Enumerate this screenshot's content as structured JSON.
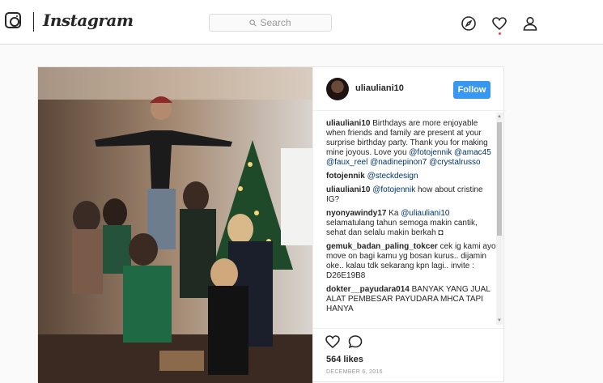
{
  "header": {
    "brand": "Instagram",
    "search_placeholder": "Search",
    "icons": [
      "instagram-logo-icon",
      "compass-icon",
      "heart-icon",
      "profile-icon"
    ],
    "notification_color": "#ed4956"
  },
  "post": {
    "username": "uliauliani10",
    "follow_label": "Follow",
    "follow_color": "#3897f0",
    "comments": [
      {
        "user": "uliauliani10",
        "parts": [
          {
            "t": " Birthdays are more enjoyable when friends and family are present at your surprise birthday party. Thank you for making mine joyous. Love you "
          },
          {
            "t": "@fotojennik",
            "m": true
          },
          {
            "t": " "
          },
          {
            "t": "@amac45",
            "m": true
          },
          {
            "t": " "
          },
          {
            "t": "@faux_reel",
            "m": true
          },
          {
            "t": " "
          },
          {
            "t": "@nadinepinon7",
            "m": true
          },
          {
            "t": " "
          },
          {
            "t": "@crystalrusso",
            "m": true
          }
        ]
      },
      {
        "user": "fotojennik",
        "parts": [
          {
            "t": " "
          },
          {
            "t": "@steckdesign",
            "m": true
          }
        ]
      },
      {
        "user": "uliauliani10",
        "parts": [
          {
            "t": " "
          },
          {
            "t": "@fotojennik",
            "m": true
          },
          {
            "t": " how about cristine IG?"
          }
        ]
      },
      {
        "user": "nyonyawindy17",
        "parts": [
          {
            "t": " Ka "
          },
          {
            "t": "@uliauliani10",
            "m": true
          },
          {
            "t": " selamatulang tahun semoga makin cantik, sehat dan selalu makin berkah ◘"
          }
        ]
      },
      {
        "user": "gemuk_badan_paling_tokcer",
        "parts": [
          {
            "t": " cek ig kami ayo move on bagi kamu yg bosan kurus.. dijamin oke.. kalau tdk sekarang kpn lagi.. invite : D26E19B8"
          }
        ]
      },
      {
        "user": "dokter__payudara014",
        "parts": [
          {
            "t": " BANYAK YANG JUAL ALAT PEMBESAR PAYUDARA MHCA TAPI HANYA"
          }
        ]
      }
    ],
    "actions": [
      "heart-icon",
      "comment-icon"
    ],
    "likes": "564 likes",
    "date": "DECEMBER 6, 2016"
  }
}
